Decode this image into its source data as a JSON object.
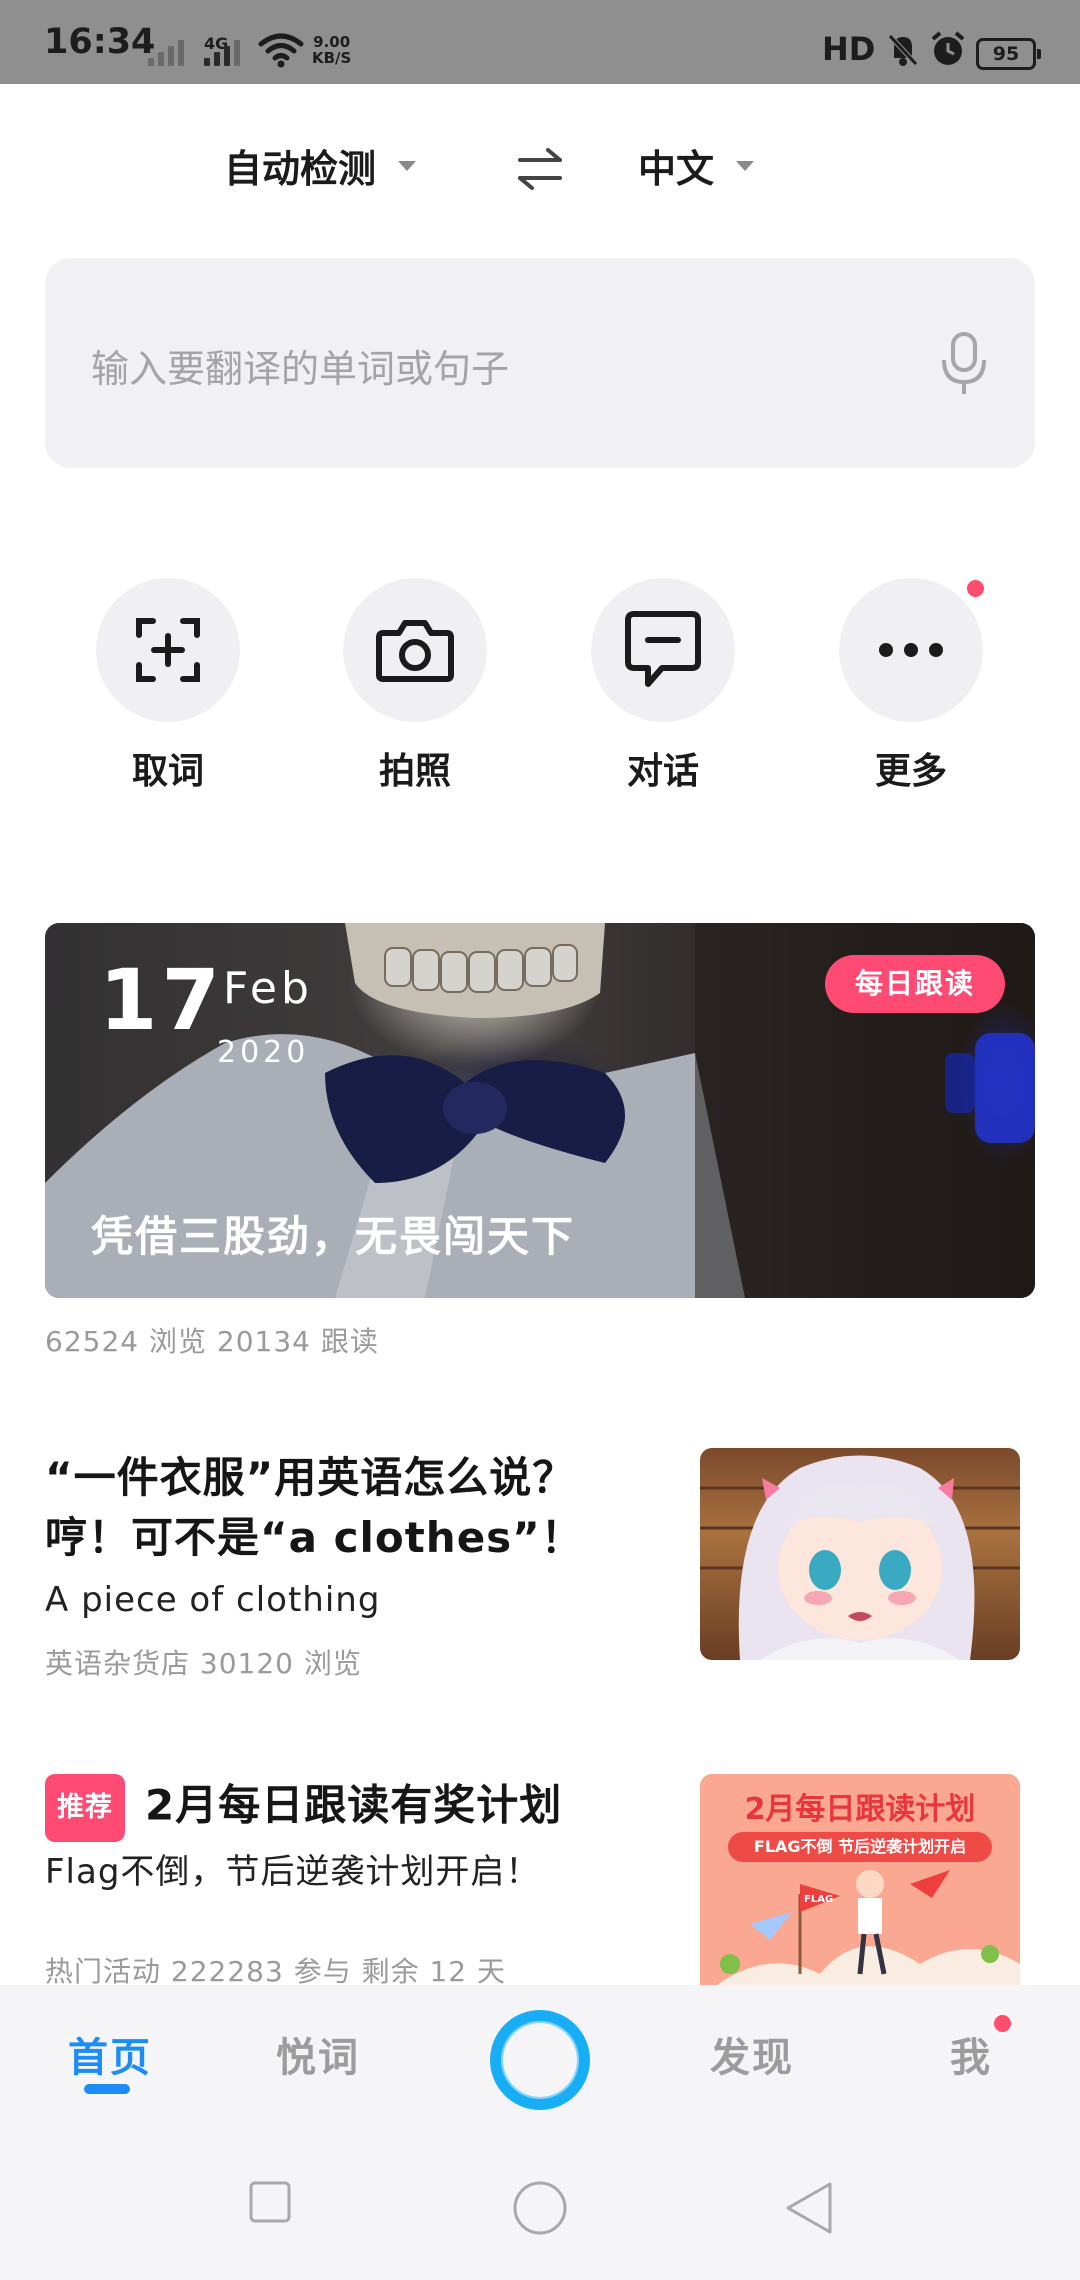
{
  "status_bar": {
    "time": "16:34",
    "network1": "4G",
    "network2": "4G",
    "speed_value": "9.00",
    "speed_unit": "KB/S",
    "hd": "HD",
    "battery": "95"
  },
  "lang": {
    "source": "自动检测",
    "target": "中文"
  },
  "input": {
    "placeholder": "输入要翻译的单词或句子"
  },
  "features": [
    {
      "label": "取词",
      "icon": "scan-word-icon"
    },
    {
      "label": "拍照",
      "icon": "camera-icon"
    },
    {
      "label": "对话",
      "icon": "chat-icon"
    },
    {
      "label": "更多",
      "icon": "more-icon"
    }
  ],
  "banner": {
    "day": "17",
    "month": "Feb",
    "year": "2020",
    "badge": "每日跟读",
    "quote": "凭借三股劲，无畏闯天下",
    "stats": "62524 浏览   20134 跟读"
  },
  "articles": [
    {
      "title_line1": "“一件衣服”用英语怎么说？",
      "title_line2": "哼！可不是“a clothes”！",
      "subtitle": "A piece of clothing",
      "meta": "英语杂货店   30120 浏览"
    },
    {
      "tag": "推荐",
      "title": "2月每日跟读有奖计划",
      "subtitle": "Flag不倒，节后逆袭计划开启！",
      "meta": "热门活动   222283 参与   剩余 12 天",
      "thumb_title": "2月每日跟读计划",
      "thumb_sub": "FLAG不倒 节后逆袭计划开启",
      "thumb_flag": "FLAG"
    }
  ],
  "nav": {
    "home": "首页",
    "words": "悦词",
    "discover": "发现",
    "me": "我"
  },
  "colors": {
    "accent": "#1c8cf6",
    "badge": "#ff4a74"
  }
}
